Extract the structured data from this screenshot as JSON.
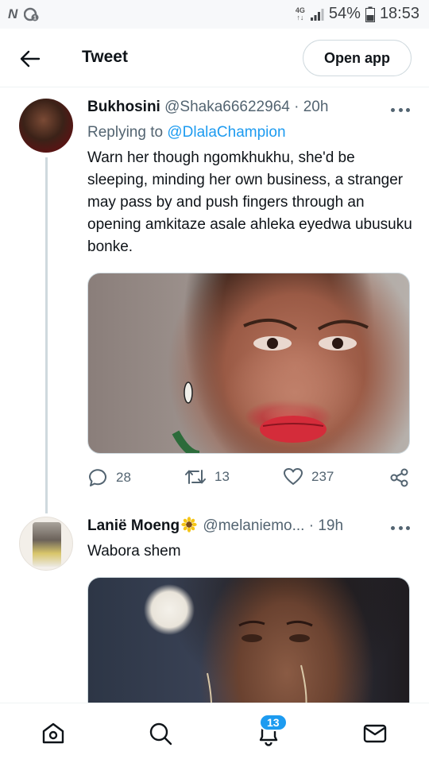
{
  "status_bar": {
    "network": "4G",
    "battery": "54%",
    "time": "18:53"
  },
  "header": {
    "title": "Tweet",
    "open_app_label": "Open app"
  },
  "tweets": [
    {
      "name": "Bukhosini",
      "handle": "@Shaka66622964",
      "time": "· 20h",
      "replying_prefix": "Replying to",
      "replying_to": "@DlalaChampion",
      "text": "Warn her though ngomkhukhu, she'd be sleeping, minding her own business, a stranger may pass by and push fingers through an opening amkitaze asale ahleka eyedwa ubusuku bonke.",
      "replies": "28",
      "retweets": "13",
      "likes": "237"
    },
    {
      "name": "Laniё Moeng",
      "handle": "@melaniemo...",
      "time": "· 19h",
      "text": "Wabora shem"
    }
  ],
  "bottom_nav": {
    "notifications_badge": "13",
    "items": [
      "home-icon",
      "search-icon",
      "notifications-icon",
      "messages-icon"
    ]
  },
  "colors": {
    "accent": "#1d9bf0",
    "secondary_text": "#536471",
    "border": "#cfd9de"
  }
}
